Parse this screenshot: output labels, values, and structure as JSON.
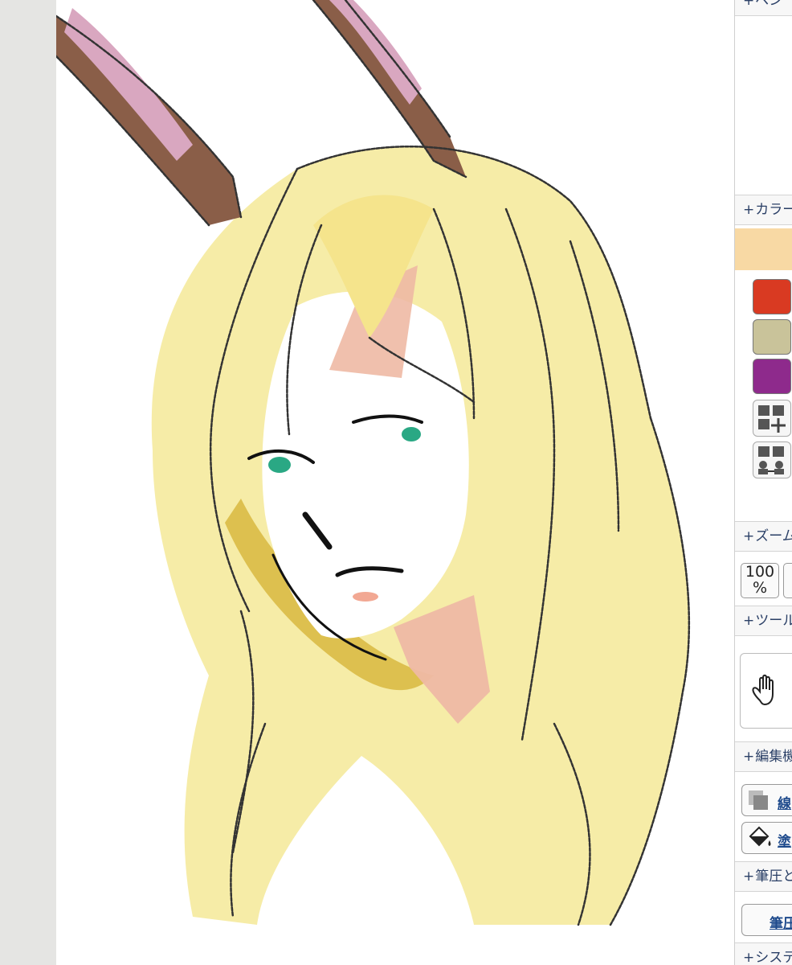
{
  "panel": {
    "sections": {
      "top": "ベン",
      "color": "カラー",
      "zoom": "ズーム",
      "tool": "ツール",
      "edit": "編集機",
      "pressure": "筆圧と",
      "system": "システ"
    },
    "current_color": "#f8d9a4",
    "swatches": [
      "#d93a22",
      "#c9c39a",
      "#8e2a8c"
    ],
    "zoom_label": "100",
    "zoom_unit": "%",
    "edit_buttons": [
      "線",
      "塗"
    ],
    "pressure_button": "筆圧"
  },
  "icons": {
    "add_palette": "palette-add-icon",
    "swap_palette": "palette-swap-icon",
    "hand_tool": "hand-icon",
    "layer_edit": "layer-icon",
    "fill_bucket": "paint-bucket-icon"
  }
}
